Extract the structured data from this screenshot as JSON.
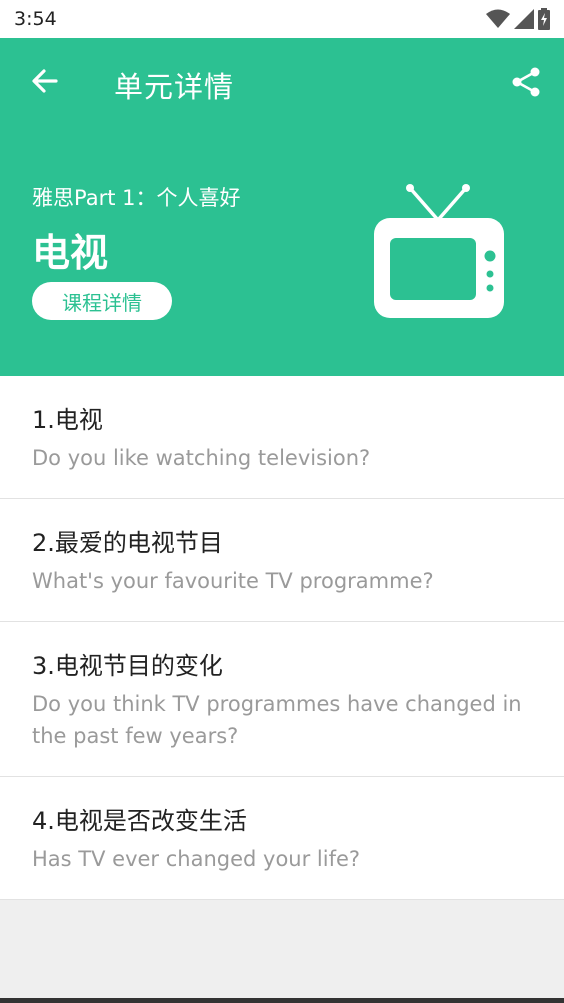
{
  "status_bar": {
    "time": "3:54"
  },
  "app_bar": {
    "title": "单元详情"
  },
  "hero": {
    "subtitle": "雅思Part 1：个人喜好",
    "title": "电视",
    "detail_button": "课程详情"
  },
  "items": [
    {
      "title": "1.电视",
      "subtitle": "Do you like watching television?"
    },
    {
      "title": "2.最爱的电视节目",
      "subtitle": "What's your favourite TV programme?"
    },
    {
      "title": "3.电视节目的变化",
      "subtitle": "Do you think TV programmes have changed in the past few years?"
    },
    {
      "title": "4.电视是否改变生活",
      "subtitle": "Has TV ever changed your life?"
    }
  ],
  "colors": {
    "primary": "#2cc192",
    "background": "#efefef"
  },
  "icons": [
    "wifi-icon",
    "signal-icon",
    "battery-icon",
    "back-arrow-icon",
    "share-icon",
    "tv-icon"
  ]
}
